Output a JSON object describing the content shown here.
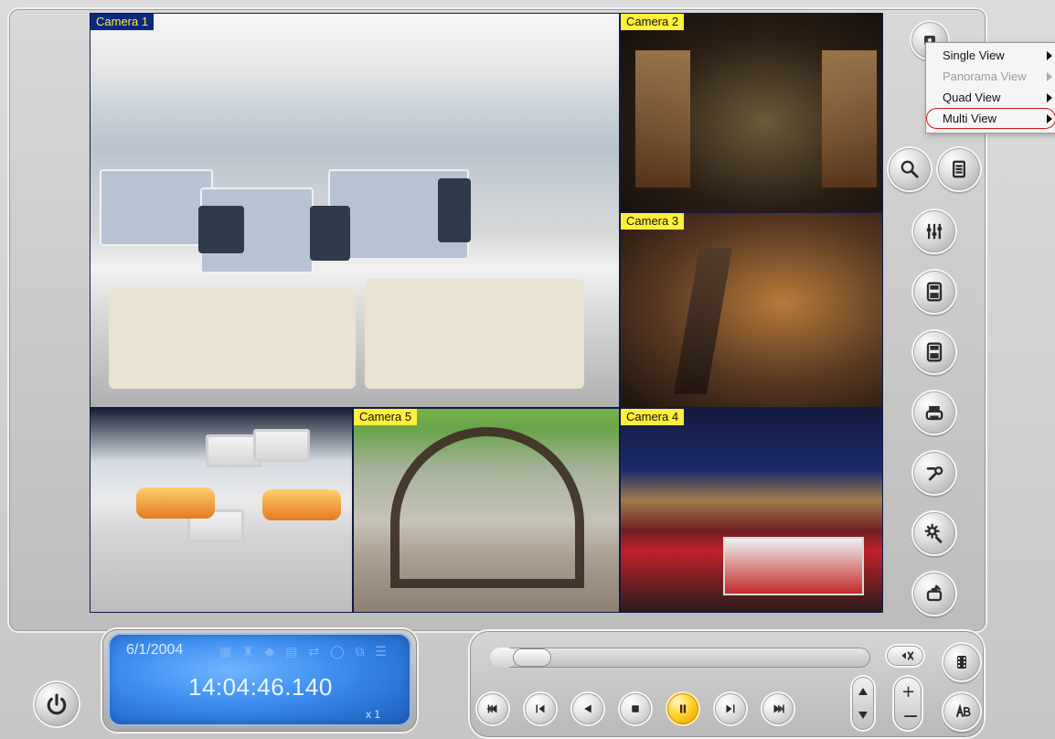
{
  "cameras": [
    {
      "id": "cam1",
      "label": "Camera 1"
    },
    {
      "id": "cam2",
      "label": "Camera 2"
    },
    {
      "id": "cam3",
      "label": "Camera 3"
    },
    {
      "id": "cam4",
      "label": "Camera 4"
    },
    {
      "id": "cam5",
      "label": "Camera 5"
    }
  ],
  "view_menu": {
    "items": [
      {
        "label": "Single View",
        "enabled": true,
        "has_submenu": true
      },
      {
        "label": "Panorama View",
        "enabled": false,
        "has_submenu": true
      },
      {
        "label": "Quad View",
        "enabled": true,
        "has_submenu": true
      },
      {
        "label": "Multi View",
        "enabled": true,
        "has_submenu": true,
        "selected": true
      }
    ]
  },
  "status": {
    "date": "6/1/2004",
    "time": "14:04:46.140",
    "speed": "x 1"
  },
  "playback": {
    "progress": 0.07
  },
  "icons": {
    "view_mode": "camera-view-icon",
    "search": "search-icon",
    "document": "document-icon",
    "mixer": "mixer-icon",
    "save_avi": "save-avi-icon",
    "save_bmp": "save-bmp-icon",
    "print": "print-icon",
    "tools": "tools-icon",
    "settings": "settings-icon",
    "export": "export-icon",
    "power": "power-icon",
    "mute": "mute-icon",
    "film": "film-icon",
    "ab": "ab-icon"
  },
  "colors": {
    "camera_label_bg": "#ffef3a",
    "camera_label_bg_alt": "#0b2a7d",
    "camera_label_fg_alt": "#ffe94a",
    "lcd_bg": "#3f8ff1",
    "pause_button": "#ffd83d",
    "menu_selected_outline": "#d11717"
  }
}
